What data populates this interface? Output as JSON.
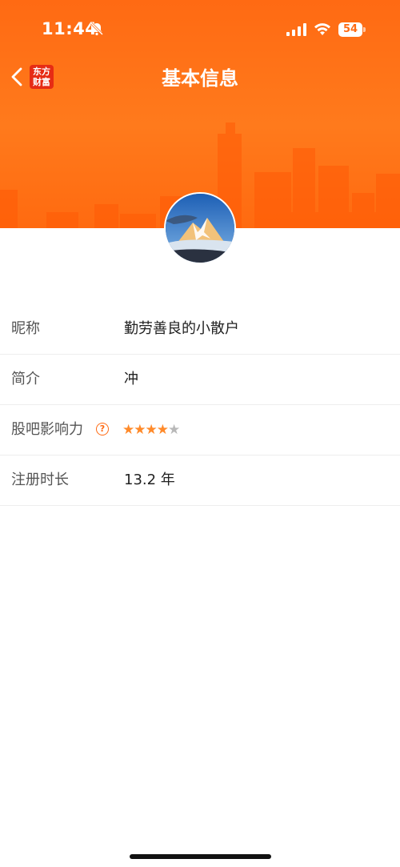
{
  "status_bar": {
    "time": "11:44",
    "battery": "54"
  },
  "nav": {
    "brand_line1": "东方",
    "brand_line2": "财富",
    "title": "基本信息"
  },
  "rows": [
    {
      "label": "昵称",
      "value": "勤劳善良的小散户"
    },
    {
      "label": "简介",
      "value": "冲"
    },
    {
      "label": "股吧影响力",
      "help": "?",
      "rating": 4,
      "rating_max": 5
    },
    {
      "label": "注册时长",
      "value": "13.2 年"
    }
  ],
  "colors": {
    "accent": "#ff6a13",
    "star_on": "#ff8a2a",
    "star_off": "#b8b8b8"
  }
}
